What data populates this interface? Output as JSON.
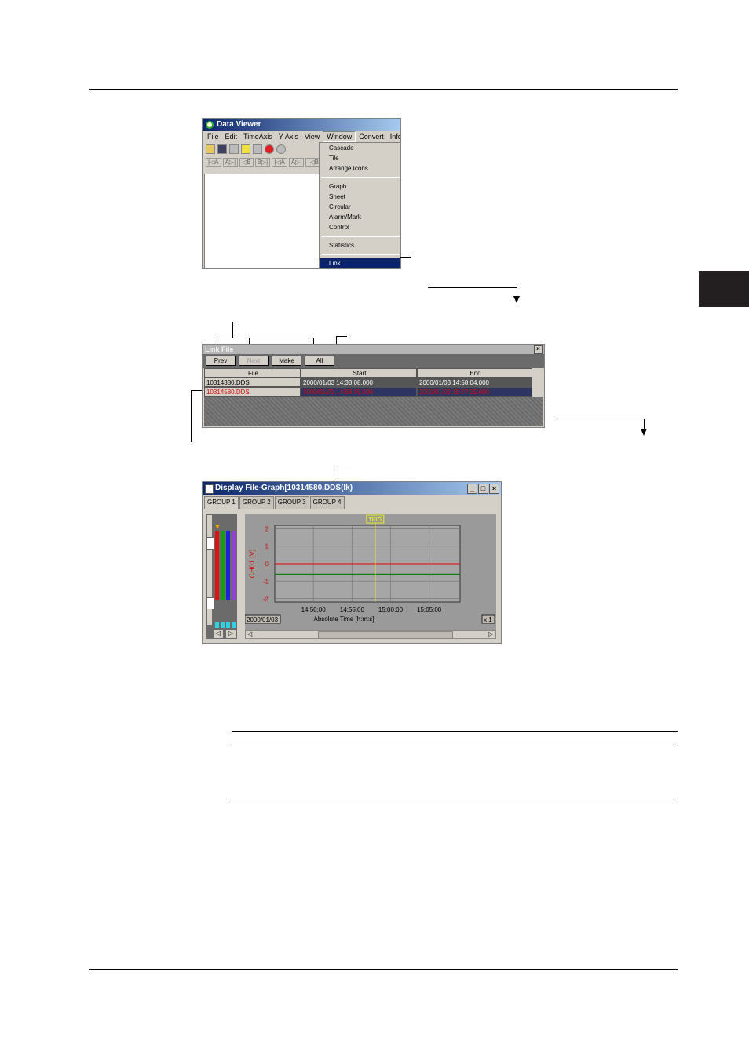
{
  "data_viewer": {
    "title": "Data Viewer",
    "menu": [
      "File",
      "Edit",
      "TimeAxis",
      "Y-Axis",
      "View",
      "Window",
      "Convert",
      "Inform"
    ],
    "window_menu_items": [
      "Cascade",
      "Tile",
      "Arrange Icons",
      "Graph",
      "Sheet",
      "Circular",
      "Alarm/Mark",
      "Control",
      "Statistics",
      "Link"
    ],
    "toolbar2": [
      "|◁A",
      "A▷|",
      "◁B",
      "B▷|",
      "|◁A",
      "A▷|",
      "|◁B",
      "B▷"
    ]
  },
  "link_file": {
    "title": "Link File",
    "buttons": [
      "Prev",
      "Next",
      "Make",
      "All"
    ],
    "columns": [
      "File",
      "Start",
      "End"
    ],
    "rows": [
      [
        "10314380.DDS",
        "2000/01/03 14:38:08.000",
        "2000/01/03 14:58:04.000"
      ],
      [
        "10314580.DDS",
        "2000/01/03 14:58:05.000",
        "2000/01/03 15:07:25.000"
      ]
    ]
  },
  "graph_window": {
    "title": "Display File-Graph[10314580.DDS(lk)",
    "tabs": [
      "GROUP 1",
      "GROUP 2",
      "GROUP 3",
      "GROUP 4"
    ],
    "date": "2000/01/03",
    "zoom": "x 1",
    "trig_label": "TRIG"
  },
  "chart_data": {
    "type": "line",
    "ylabel": "CH01 [V]",
    "xlabel": "Absolute Time [h:m:s]",
    "yticks": [
      "2",
      "1",
      "0",
      "-1",
      "-2"
    ],
    "xticks": [
      "14:50:00",
      "14:55:00",
      "15:00:00",
      "15:05:00"
    ],
    "ylim": [
      -2.2,
      2.2
    ],
    "x_minutes_from": "14:45:00",
    "xlim_minutes": [
      0,
      24
    ],
    "series": [
      {
        "color": "#e02020",
        "x": [
          0,
          24
        ],
        "y": [
          0,
          0
        ]
      },
      {
        "color": "#108010",
        "x": [
          0,
          24
        ],
        "y": [
          -0.6,
          -0.6
        ]
      }
    ],
    "trig_x_minutes": 13,
    "grid": true
  }
}
